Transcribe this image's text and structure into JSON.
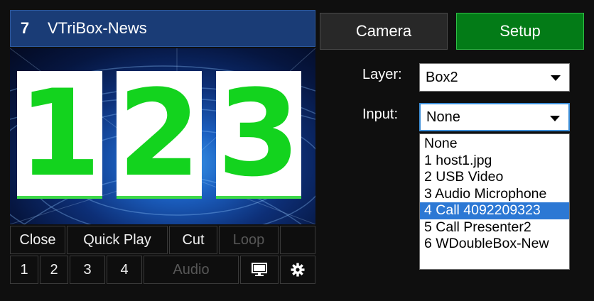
{
  "preview": {
    "number": "7",
    "name": "VTriBox-News",
    "cards": [
      "1",
      "2",
      "3"
    ]
  },
  "controls": {
    "row1": [
      "Close",
      "Quick Play",
      "Cut",
      "Loop"
    ],
    "row2": [
      "1",
      "2",
      "3",
      "4"
    ],
    "audio": "Audio",
    "monitor_icon": "monitor-icon",
    "gear_icon": "gear-icon"
  },
  "tabs": {
    "camera": "Camera",
    "setup": "Setup"
  },
  "layer": {
    "label": "Layer:",
    "value": "Box2"
  },
  "input": {
    "label": "Input:",
    "value": "None",
    "options": [
      "None",
      "1 host1.jpg",
      "2 USB Video",
      "3 Audio Microphone",
      "4 Call 4092209323",
      "5 Call Presenter2",
      "6 WDoubleBox-New"
    ],
    "highlighted": "4 Call 4092209323"
  },
  "colors": {
    "title_bg": "#1a3c76",
    "setup_bg": "#037b17",
    "card_digit": "#13d31e",
    "highlight": "#2c78d4"
  }
}
